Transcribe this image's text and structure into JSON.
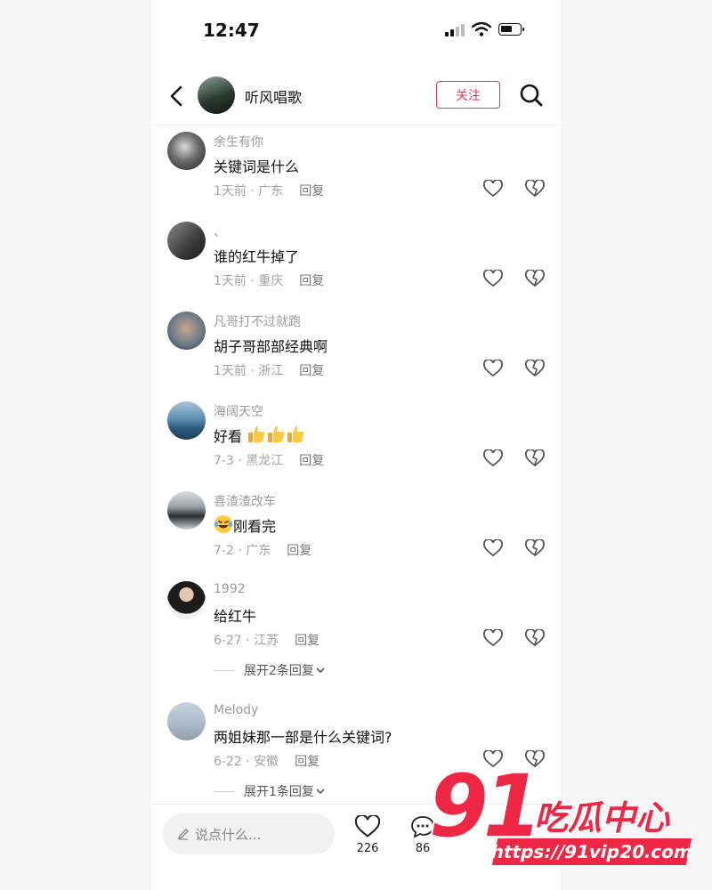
{
  "status": {
    "time": "12:47"
  },
  "header": {
    "username": "听风唱歌",
    "follow_label": "关注"
  },
  "colors": {
    "accent": "#e8374f",
    "watermark": "#f02645"
  },
  "comments": [
    {
      "name": "余生有你",
      "text": "关键词是什么",
      "meta": "1天前 · 广东",
      "reply": "回复"
    },
    {
      "name": "、",
      "text": "谁的红牛掉了",
      "meta": "1天前 · 重庆",
      "reply": "回复"
    },
    {
      "name": "凡哥打不过就跑",
      "text": "胡子哥部部经典啊",
      "meta": "1天前 · 浙江",
      "reply": "回复"
    },
    {
      "name": "海阔天空",
      "text": "好看",
      "emoji": "thumbs-up x3",
      "meta": "7-3 · 黑龙江",
      "reply": "回复"
    },
    {
      "name": "喜渣渣改车",
      "text": "刚看完",
      "emoji": "laughing-crying",
      "meta": "7-2 · 广东",
      "reply": "回复"
    },
    {
      "name": "1992",
      "text": "给红牛",
      "meta": "6-27 · 江苏",
      "reply": "回复",
      "expand": "展开2条回复"
    },
    {
      "name": "Melody",
      "text": "两姐妹那一部是什么关键词?",
      "meta": "6-22 · 安徽",
      "reply": "回复",
      "expand": "展开1条回复"
    }
  ],
  "bottom": {
    "input_placeholder": "说点什么...",
    "likes": "226",
    "comments": "86"
  },
  "watermark": {
    "number": "91",
    "title": "吃瓜中心",
    "url": "https://91vip20.com"
  }
}
